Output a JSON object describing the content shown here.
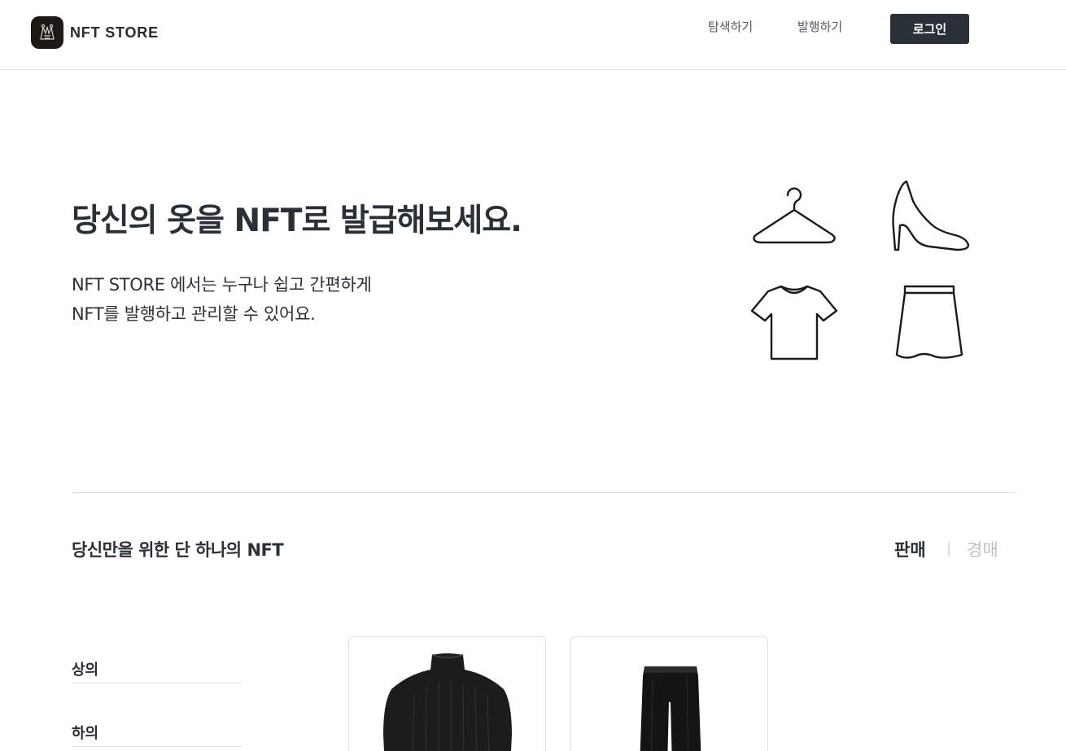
{
  "header": {
    "brand": "NFT STORE",
    "nav": {
      "explore": "탐색하기",
      "issue": "발행하기"
    },
    "login_label": "로그인"
  },
  "hero": {
    "title": "당신의 옷을 NFT로 발급해보세요.",
    "description_line1": "NFT STORE 에서는 누구나 쉽고 간편하게",
    "description_line2": "NFT를 발행하고 관리할 수 있어요.",
    "icons": [
      "hanger-icon",
      "high-heel-icon",
      "tshirt-icon",
      "skirt-icon"
    ]
  },
  "section": {
    "title": "당신만을 위한 단 하나의 NFT",
    "tabs": {
      "sale": "판매",
      "separator": "|",
      "auction": "경매"
    },
    "active_tab": "판매"
  },
  "categories": [
    {
      "label": "상의"
    },
    {
      "label": "하의"
    }
  ],
  "products": [
    {
      "image": "black-turtleneck-sweater"
    },
    {
      "image": "black-trousers"
    }
  ],
  "colors": {
    "primary": "#2a3038",
    "inactive_tab": "#bfbfbf",
    "border": "#e4e4e4"
  }
}
